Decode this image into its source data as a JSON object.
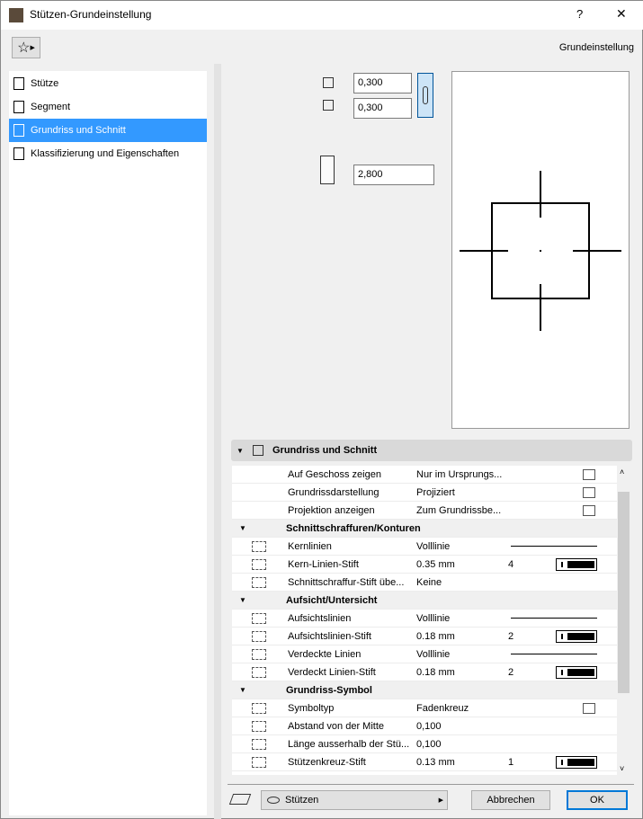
{
  "window": {
    "title": "Stützen-Grundeinstellung",
    "help": "?",
    "close": "✕"
  },
  "toolbar": {
    "favorites": "☆",
    "mode": "Grundeinstellung"
  },
  "nav": [
    {
      "label": "Stütze"
    },
    {
      "label": "Segment"
    },
    {
      "label": "Grundriss und Schnitt",
      "selected": true
    },
    {
      "label": "Klassifizierung und Eigenschaften"
    }
  ],
  "dimensions": {
    "width": "0,300",
    "depth": "0,300",
    "height": "2,800"
  },
  "section": {
    "title": "Grundriss und Schnitt"
  },
  "rows": [
    {
      "type": "item",
      "label": "Auf Geschoss zeigen",
      "value": "Nur im Ursprungs...",
      "icon": "story-icon"
    },
    {
      "type": "item",
      "label": "Grundrissdarstellung",
      "value": "Projiziert",
      "icon": "projected-icon"
    },
    {
      "type": "item",
      "label": "Projektion anzeigen",
      "value": "Zum Grundrissbe...",
      "icon": "projection-icon"
    },
    {
      "type": "group",
      "label": "Schnittschraffuren/Konturen"
    },
    {
      "type": "item",
      "label": "Kernlinien",
      "value": "Volllinie",
      "line": true
    },
    {
      "type": "item",
      "label": "Kern-Linien-Stift",
      "value": "0.35 mm",
      "num": "4",
      "pen": true
    },
    {
      "type": "item",
      "label": "Schnittschraffur-Stift übe...",
      "value": "Keine"
    },
    {
      "type": "group",
      "label": "Aufsicht/Untersicht"
    },
    {
      "type": "item",
      "label": "Aufsichtslinien",
      "value": "Volllinie",
      "line": true
    },
    {
      "type": "item",
      "label": "Aufsichtslinien-Stift",
      "value": "0.18 mm",
      "num": "2",
      "pen": true
    },
    {
      "type": "item",
      "label": "Verdeckte Linien",
      "value": "Volllinie",
      "line": true
    },
    {
      "type": "item",
      "label": "Verdeckt Linien-Stift",
      "value": "0.18 mm",
      "num": "2",
      "pen": true
    },
    {
      "type": "group",
      "label": "Grundriss-Symbol"
    },
    {
      "type": "item",
      "label": "Symboltyp",
      "value": "Fadenkreuz",
      "icon": "crosshair-icon"
    },
    {
      "type": "item",
      "label": "Abstand von der Mitte",
      "value": "0,100"
    },
    {
      "type": "item",
      "label": "Länge ausserhalb der Stü...",
      "value": "0,100"
    },
    {
      "type": "item",
      "label": "Stützenkreuz-Stift",
      "value": "0.13 mm",
      "num": "1",
      "pen": true
    }
  ],
  "footer": {
    "layer": "Stützen",
    "cancel": "Abbrechen",
    "ok": "OK"
  },
  "colors": {
    "selection": "#3399ff",
    "ok_border": "#0078d7"
  }
}
